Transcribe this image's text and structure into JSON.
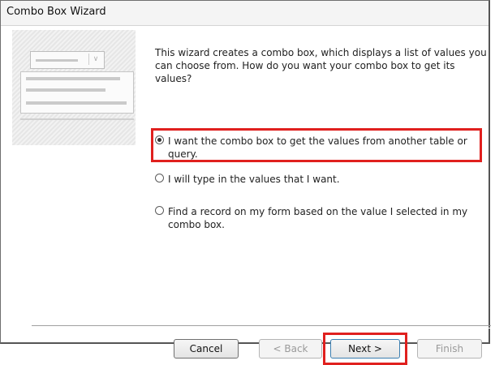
{
  "window": {
    "title": "Combo Box Wizard"
  },
  "description": "This wizard creates a combo box, which displays a list of values you can choose from.  How do you want your combo box to get its values?",
  "options": [
    {
      "label": "I want the combo box to get the values from another table or query.",
      "selected": true
    },
    {
      "label": "I will type in the values that I want.",
      "selected": false
    },
    {
      "label": "Find a record on my form based on the value I selected in my combo box.",
      "selected": false
    }
  ],
  "buttons": {
    "cancel": "Cancel",
    "back": "< Back",
    "next": "Next >",
    "finish": "Finish"
  },
  "colors": {
    "highlight": "#e0201e"
  }
}
